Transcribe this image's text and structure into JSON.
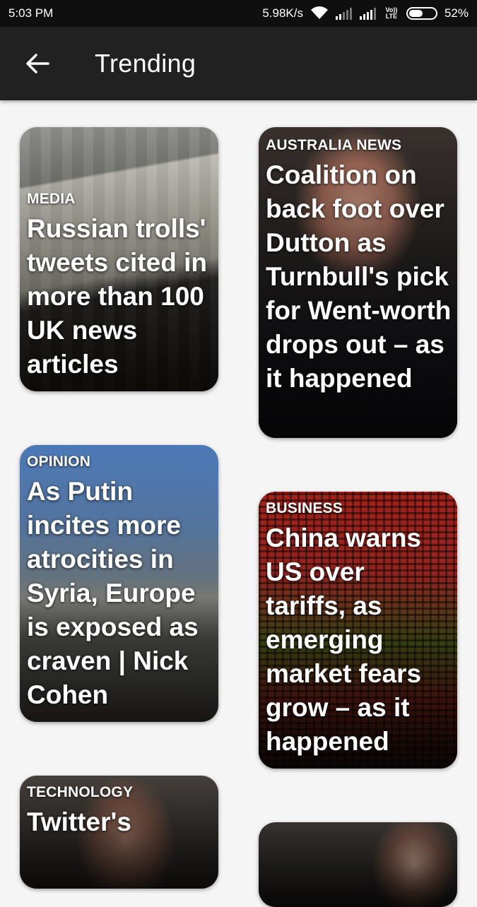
{
  "status_bar": {
    "time": "5:03 PM",
    "speed": "5.98K/s",
    "volte": "Vo)) LTE",
    "battery": "52%"
  },
  "app_bar": {
    "title": "Trending",
    "back_icon": "arrow-back-icon"
  },
  "cards": [
    {
      "category": "MEDIA",
      "headline": "Russian trolls' tweets cited in more than 100 UK news articles"
    },
    {
      "category": "AUSTRALIA NEWS",
      "headline": "Coalition on back foot over Dutton as Turnbull's pick for Went-worth drops out – as it happened"
    },
    {
      "category": "OPINION",
      "headline": "As Putin incites more atrocities in Syria, Europe is exposed as craven | Nick Cohen"
    },
    {
      "category": "BUSINESS",
      "headline": "China warns US over tariffs, as emerging market fears grow – as it happened"
    },
    {
      "category": "TECHNOLOGY",
      "headline": "Twitter's"
    }
  ],
  "colors": {
    "status_bar": "#0f0f0f",
    "app_bar": "#212121",
    "background": "#f5f5f5",
    "text": "#ffffff"
  }
}
